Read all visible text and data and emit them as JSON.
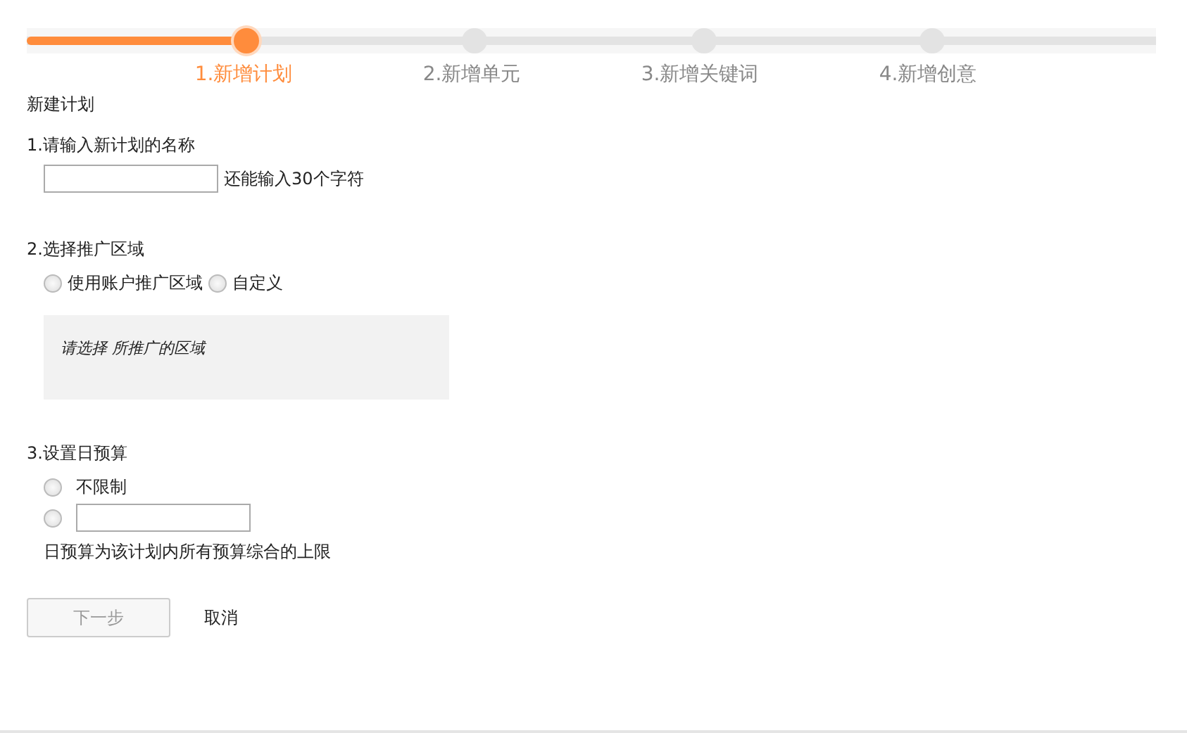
{
  "progress": {
    "level": 0.194
  },
  "steps": [
    {
      "label": "1.新增计划",
      "selected": true
    },
    {
      "label": "2.新增单元",
      "selected": false
    },
    {
      "label": "3.新增关键词",
      "selected": false
    },
    {
      "label": "4.新增创意",
      "selected": false
    }
  ],
  "page_title": "新建计划",
  "name_section": {
    "title": "1.请输入新计划的名称",
    "hint": "还能输入30个字符"
  },
  "region_section": {
    "title": "2.选择推广区域",
    "options": [
      {
        "label": "使用账户推广区域",
        "selected": false
      },
      {
        "label": "自定义",
        "selected": false
      }
    ],
    "region_placeholder": "请选择 所推广的区域"
  },
  "budget_section": {
    "title": "3.设置日预算",
    "options": [
      {
        "kind": "label",
        "label": "不限制",
        "selected": false
      },
      {
        "kind": "input",
        "selected": false
      }
    ],
    "note": "日预算为该计划内所有预算综合的上限"
  },
  "buttons": {
    "next": {
      "label": "下一步",
      "disabled": true
    },
    "cancel": {
      "label": "取消"
    }
  }
}
